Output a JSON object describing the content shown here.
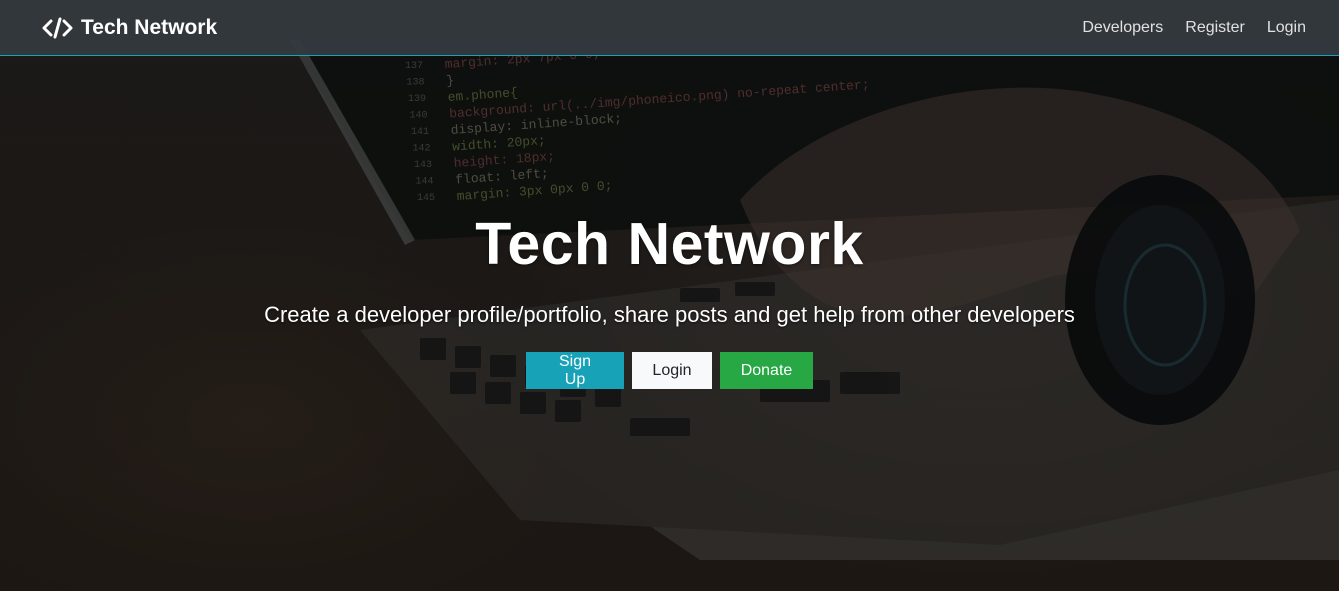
{
  "navbar": {
    "brand_icon": "code-icon",
    "brand_label": "Tech Network",
    "links": [
      {
        "label": "Developers"
      },
      {
        "label": "Register"
      },
      {
        "label": "Login"
      }
    ],
    "border_color": "#17a2b8"
  },
  "background": {
    "code_lines": [
      {
        "num": "137",
        "text": "margin: 2px 7px 0 0;"
      },
      {
        "num": "138",
        "text": "}"
      },
      {
        "num": "139",
        "text": "em.phone{"
      },
      {
        "num": "140",
        "text": "background: url(../img/phoneico.png) no-repeat center;"
      },
      {
        "num": "141",
        "text": "display: inline-block;"
      },
      {
        "num": "142",
        "text": "width: 20px;"
      },
      {
        "num": "143",
        "text": "height: 18px;"
      },
      {
        "num": "144",
        "text": "float: left;"
      },
      {
        "num": "145",
        "text": "margin: 3px 0px 0 0;"
      }
    ]
  },
  "hero": {
    "title": "Tech Network",
    "lead": "Create a developer profile/portfolio, share posts and get help from other developers",
    "buttons": {
      "signup": "Sign Up",
      "login": "Login",
      "donate": "Donate"
    }
  },
  "colors": {
    "info": "#17a2b8",
    "light": "#f8f9fa",
    "success": "#28a745",
    "navbar": "#343a40"
  }
}
